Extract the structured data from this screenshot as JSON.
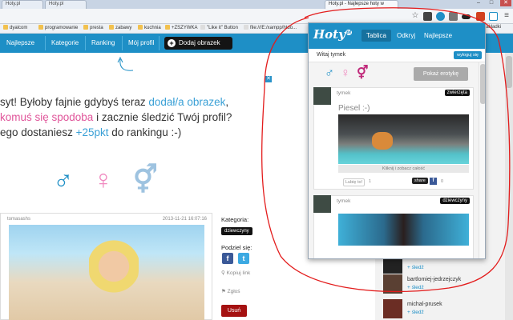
{
  "browser": {
    "tabs": [
      {
        "label": "Hoty.pl"
      },
      {
        "label": "Hoty.pl"
      },
      {
        "label": "Hoty.pl - Najlepsze hoty w"
      }
    ],
    "window_controls": {
      "minimize": "–",
      "maximize": "□",
      "close": "✕"
    },
    "bookmarks": [
      {
        "label": "dyalcom"
      },
      {
        "label": "programowanie"
      },
      {
        "label": "presta"
      },
      {
        "label": "zabawy"
      },
      {
        "label": "kuchnia"
      },
      {
        "label": "+ZSZYWKA"
      },
      {
        "label": "\"Like it\" Button"
      },
      {
        "label": "file:///E:/xampp/htdo..."
      },
      {
        "label": "Inne zakładki"
      }
    ]
  },
  "site": {
    "nav": [
      "Najlepsze",
      "Kategorie",
      "Ranking",
      "Mój profil"
    ],
    "add_button": "Dodaj obrazek",
    "add_plus": "+",
    "hero": {
      "line1_a": "syt! Byłoby fajnie gdybyś teraz ",
      "line1_b": "dodał/a obrazek",
      "line1_c": ",",
      "line2_a": "komuś się spodoba",
      "line2_b": " i zacznie śledzić Twój profil?",
      "line3_a": "ego dostaniesz ",
      "line3_b": "+25pkt",
      "line3_c": " do rankingu :-)"
    },
    "close_x": "✕",
    "gender_symbols": [
      "♂",
      "♀",
      "⚥"
    ],
    "post": {
      "author": "tomasashs",
      "date": "2013-11-21 16:07:16"
    },
    "sidebar": {
      "category_label": "Kategoria:",
      "category_value": "dziewczyny",
      "share_label": "Podziel się:",
      "fb": "f",
      "tw": "t",
      "copy_link": "Kopiuj link",
      "report": "Zgłoś",
      "delete": "Usuń"
    },
    "right_users": [
      {
        "name": "",
        "follow": "+ śledź"
      },
      {
        "name": "bartlomiej-jedrzejczyk",
        "follow": "+ śledź"
      },
      {
        "name": "michal-prusek",
        "follow": "+ śledź"
      }
    ]
  },
  "popup": {
    "logo": "Hoty",
    "logo_sup": "pl",
    "tabs": [
      "Tablica",
      "Odkryj",
      "Najlepsze"
    ],
    "welcome": "Witaj tymek",
    "logout": "wyloguj się",
    "show_erotic": "Pokaż erotykę",
    "gender_symbols": [
      "♂",
      "♀",
      "⚥"
    ],
    "posts": [
      {
        "author": "tymek",
        "badge": "zwierzęta",
        "title": "Piesel :-)",
        "click_label": "Kliknij i zobacz całość",
        "like": "Lubię to!",
        "like_count": "1",
        "share": "share",
        "fb": "f",
        "fb_count": "0"
      },
      {
        "author": "tymek",
        "badge": "dziewczyny"
      }
    ]
  },
  "colors": {
    "brand_blue": "#1e8fc6",
    "pink": "#e0559a",
    "annotation_red": "#e31c1c"
  }
}
